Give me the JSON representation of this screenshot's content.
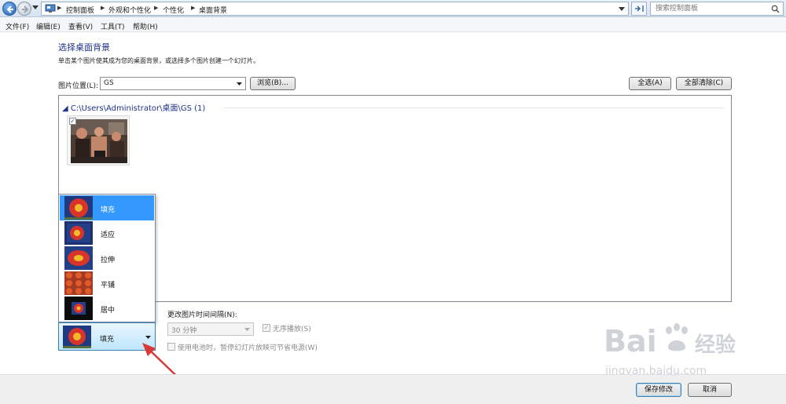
{
  "addressbar": {
    "crumbs": [
      "控制面板",
      "外观和个性化",
      "个性化",
      "桌面背景"
    ],
    "search_placeholder": "搜索控制面板"
  },
  "menubar": {
    "items": [
      "文件(F)",
      "编辑(E)",
      "查看(V)",
      "工具(T)",
      "帮助(H)"
    ]
  },
  "content": {
    "title": "选择桌面背景",
    "description": "单击某个图片使其成为您的桌面背景，或选择多个图片创建一个幻灯片。",
    "location_label": "图片位置(L):",
    "location_value": "GS",
    "browse_label": "浏览(B)...",
    "select_all_label": "全选(A)",
    "clear_all_label": "全部清除(C)",
    "group_header": "C:\\Users\\Administrator\\桌面\\GS (1)",
    "thumbnail_checked": true
  },
  "position": {
    "options": [
      "填充",
      "适应",
      "拉伸",
      "平铺",
      "居中"
    ],
    "selected_index": 0,
    "combo_value": "填充"
  },
  "slideshow": {
    "interval_label": "更改图片时间间隔(N):",
    "interval_value": "30 分钟",
    "shuffle_label": "无序播放(S)",
    "shuffle_checked": true,
    "battery_label": "使用电池时，暂停幻灯片放映可节省电源(W)",
    "battery_checked": false
  },
  "footer": {
    "save_label": "保存修改",
    "cancel_label": "取消"
  },
  "watermark": {
    "brand": "Bai",
    "brand_suffix": "经验",
    "url": "jingyan.baidu.com"
  },
  "colors": {
    "accent": "#3399ff",
    "title_blue": "#1e3287",
    "annotation_red": "#d83a3a"
  }
}
